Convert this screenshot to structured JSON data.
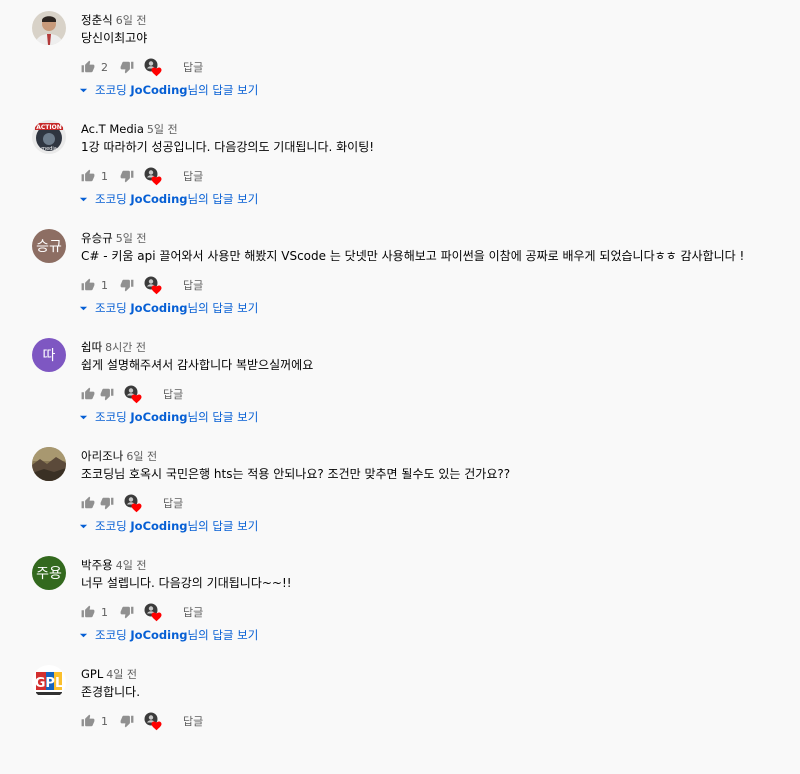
{
  "comments": [
    {
      "author": "정춘식",
      "time": "6일 전",
      "text": "당신이최고야",
      "likes": "2",
      "reply": "답글",
      "replies": {
        "prefix": "조코딩 ",
        "name": "JoCoding",
        "suffix": "님의 답글 보기"
      },
      "avatar": {
        "type": "photo",
        "icon": "person-photo-icon",
        "color": "#b23a3a"
      }
    },
    {
      "author": "Ac.T Media",
      "time": "5일 전",
      "text": "1강 따라하기 성공입니다. 다음강의도 기대됩니다. 화이팅!",
      "likes": "1",
      "reply": "답글",
      "replies": {
        "prefix": "조코딩 ",
        "name": "JoCoding",
        "suffix": "님의 답글 보기"
      },
      "avatar": {
        "type": "photo",
        "icon": "action-logo-icon",
        "color": "#2f3540"
      }
    },
    {
      "author": "유승규",
      "time": "5일 전",
      "text": "C# - 키움 api 끌어와서 사용만 해봤지 VScode 는 닷넷만 사용해보고 파이썬을 이참에  공짜로 배우게 되었습니다ㅎㅎ 감사합니다 !",
      "likes": "1",
      "reply": "답글",
      "replies": {
        "prefix": "조코딩 ",
        "name": "JoCoding",
        "suffix": "님의 답글 보기"
      },
      "avatar": {
        "type": "initials",
        "initials": "승규",
        "color": "#8d6e63"
      }
    },
    {
      "author": "쉽따",
      "time": "8시간 전",
      "text": "쉽게 설명해주셔서 감사합니다 복받으실꺼에요",
      "likes": "",
      "reply": "답글",
      "replies": {
        "prefix": "조코딩 ",
        "name": "JoCoding",
        "suffix": "님의 답글 보기"
      },
      "avatar": {
        "type": "initials",
        "initials": "따",
        "color": "#7e57c2"
      }
    },
    {
      "author": "아리조나",
      "time": "6일 전",
      "text": "조코딩님 호옥시 국민은행 hts는 적용 안되나요? 조건만 맞추면 될수도 있는 건가요??",
      "likes": "",
      "reply": "답글",
      "replies": {
        "prefix": "조코딩 ",
        "name": "JoCoding",
        "suffix": "님의 답글 보기"
      },
      "avatar": {
        "type": "photo",
        "icon": "landscape-photo-icon",
        "color": "#5b4a3a"
      }
    },
    {
      "author": "박주용",
      "time": "4일 전",
      "text": "너무 설렙니다. 다음강의 기대됩니다~~!!",
      "likes": "1",
      "reply": "답글",
      "replies": {
        "prefix": "조코딩 ",
        "name": "JoCoding",
        "suffix": "님의 답글 보기"
      },
      "avatar": {
        "type": "initials",
        "initials": "주용",
        "color": "#33691e"
      }
    },
    {
      "author": "GPL",
      "time": "4일 전",
      "text": "존경합니다.",
      "likes": "1",
      "reply": "답글",
      "replies": null,
      "avatar": {
        "type": "photo",
        "icon": "gpl-logo-icon",
        "color": "#ffffff"
      }
    }
  ]
}
